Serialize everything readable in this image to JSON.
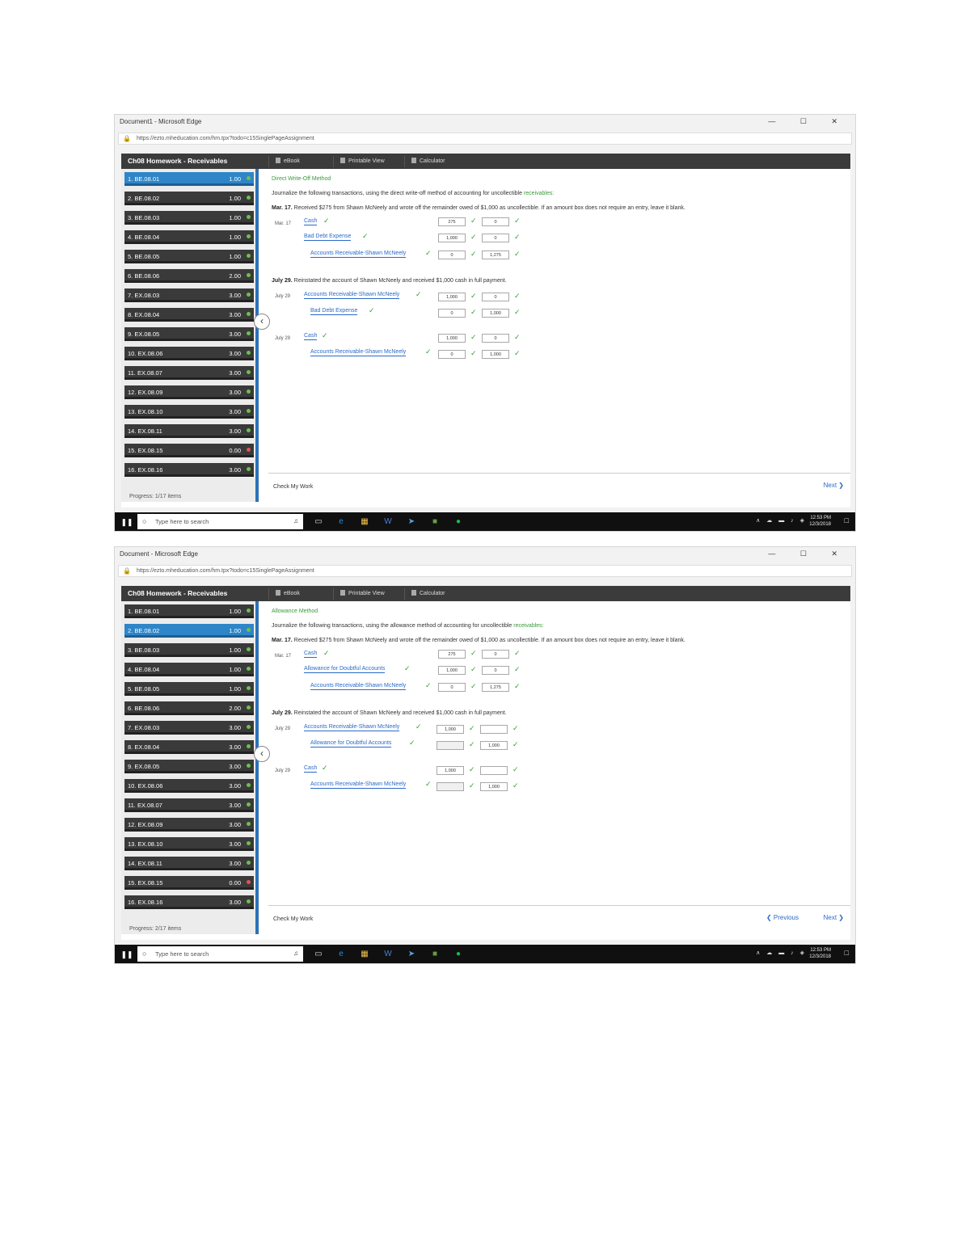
{
  "window_title_1": "Document1 - Microsoft Edge",
  "window_title_2": "Document - Microsoft Edge",
  "window_controls": "— ☐ ✕",
  "url": "https://ezto.mheducation.com/hm.tpx?todo=c15SinglePageAssignment",
  "homework_title": "Ch08 Homework - Receivables",
  "tabs": [
    "eBook",
    "Printable View",
    "Calculator"
  ],
  "questions": [
    {
      "label": "1. BE.08.01",
      "score": "1.00",
      "status": "green"
    },
    {
      "label": "2. BE.08.02",
      "score": "1.00",
      "status": "green"
    },
    {
      "label": "3. BE.08.03",
      "score": "1.00",
      "status": "green"
    },
    {
      "label": "4. BE.08.04",
      "score": "1.00",
      "status": "green"
    },
    {
      "label": "5. BE.08.05",
      "score": "1.00",
      "status": "green"
    },
    {
      "label": "6. BE.08.06",
      "score": "2.00",
      "status": "green"
    },
    {
      "label": "7. EX.08.03",
      "score": "3.00",
      "status": "green"
    },
    {
      "label": "8. EX.08.04",
      "score": "3.00",
      "status": "green"
    },
    {
      "label": "9. EX.08.05",
      "score": "3.00",
      "status": "green"
    },
    {
      "label": "10. EX.08.06",
      "score": "3.00",
      "status": "green"
    },
    {
      "label": "11. EX.08.07",
      "score": "3.00",
      "status": "green"
    },
    {
      "label": "12. EX.08.09",
      "score": "3.00",
      "status": "green"
    },
    {
      "label": "13. EX.08.10",
      "score": "3.00",
      "status": "green"
    },
    {
      "label": "14. EX.08.11",
      "score": "3.00",
      "status": "green"
    },
    {
      "label": "15. EX.08.15",
      "score": "0.00",
      "status": "red"
    },
    {
      "label": "16. EX.08.16",
      "score": "3.00",
      "status": "green"
    }
  ],
  "progress_1": "Progress: 1/17 items",
  "progress_2": "Progress: 2/17 items",
  "panel1": {
    "section_title": "Direct Write-Off Method",
    "instruction": "Journalize the following transactions, using the direct write-off method of accounting for uncollectible",
    "instruction_kw": "receivables:",
    "desc_mar": "Received $275 from Shawn McNeely and wrote off the remainder owed of $1,000 as uncollectible. If an amount box does not require an entry, leave it blank.",
    "desc_jul": "Reinstated the account of Shawn McNeely and received $1,000 cash in full payment.",
    "date_mar": "Mar. 17",
    "date_jul": "July 29",
    "date_jul_2": "July 29",
    "acct_cash": "Cash",
    "acct_bde": "Bad Debt Expense",
    "acct_ar": "Accounts Receivable-Shawn McNeely",
    "v_cash_dr": "275",
    "v_cash_cr": "0",
    "v_bde_dr": "1,000",
    "v_bde_cr": "0",
    "v_ar_dr": "0",
    "v_ar_cr": "1,275",
    "v_j2_ar_dr": "1,000",
    "v_j2_ar_cr": "0",
    "v_j2_bde_dr": "0",
    "v_j2_bde_cr": "1,000",
    "v_j3_cash_dr": "1,000",
    "v_j3_cash_cr": "0",
    "v_j3_ar_dr": "0",
    "v_j3_ar_cr": "1,000"
  },
  "panel2": {
    "section_title": "Allowance Method",
    "instruction": "Journalize the following transactions, using the allowance method of accounting for uncollectible",
    "instruction_kw": "receivables:",
    "desc_mar": "Received $275 from Shawn McNeely and wrote off the remainder owed of $1,000 as uncollectible. If an amount box does not require an entry, leave it blank.",
    "desc_jul": "Reinstated the account of Shawn McNeely and received $1,000 cash in full payment.",
    "date_mar": "Mar. 17",
    "date_jul": "July 29",
    "date_jul_2": "July 29",
    "acct_cash": "Cash",
    "acct_afda": "Allowance for Doubtful Accounts",
    "acct_ar": "Accounts Receivable-Shawn McNeely",
    "v_cash_dr": "275",
    "v_cash_cr": "0",
    "v_afda_dr": "1,000",
    "v_afda_cr": "0",
    "v_ar_dr": "0",
    "v_ar_cr": "1,275",
    "v_j2_ar_dr": "1,000",
    "v_j2_ar_cr": "",
    "v_j2_afda_dr": "",
    "v_j2_afda_cr": "1,000",
    "v_j3_cash_dr": "1,000",
    "v_j3_cash_cr": "",
    "v_j3_ar_dr": "",
    "v_j3_ar_cr": "1,000"
  },
  "mar_label": "Mar. 17.",
  "jul_label": "July 29.",
  "check_work": "Check My Work",
  "prev_label": "Previous",
  "next_label": "Next",
  "taskbar": {
    "search_placeholder": "Type here to search",
    "time": "12:53 PM",
    "date": "12/3/2018",
    "app_colors": [
      "#3a3a3a",
      "#1c8fe0",
      "#f2c14b",
      "#2b5fbf",
      "#1f7fd0",
      "#6a9b3c",
      "#1db954"
    ]
  }
}
